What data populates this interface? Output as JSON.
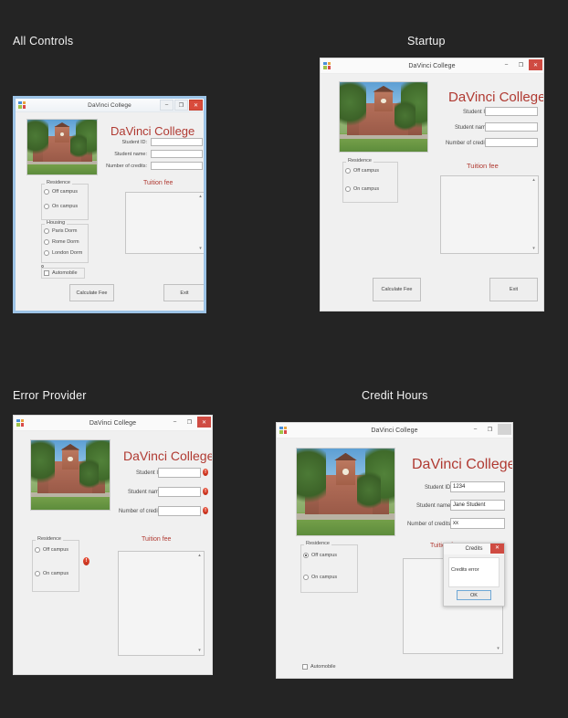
{
  "background_color": "#242424",
  "sections": [
    {
      "id": "all-controls",
      "label": "All Controls"
    },
    {
      "id": "startup",
      "label": "Startup"
    },
    {
      "id": "error-provider",
      "label": "Error Provider"
    },
    {
      "id": "credit-hours",
      "label": "Credit Hours"
    }
  ],
  "window_title": "DaVinci College",
  "brand": "DaVinci College",
  "colors": {
    "brand_red": "#b03a32",
    "accent_blue": "#9dc3e6",
    "close_red": "#d94b3c",
    "error_red": "#c22d18"
  },
  "window_buttons": {
    "minimize": "–",
    "maximize": "❐",
    "close": "✕"
  },
  "form": {
    "labels": {
      "student_id": "Student ID:",
      "student_name": "Student name:",
      "number_of_credits": "Number of credits:"
    },
    "tuition_fee_title": "Tuition fee",
    "residence_group": "Residence",
    "residence_options": [
      "Off campus",
      "On campus"
    ],
    "housing_group": "Housing",
    "housing_options": [
      "Paris Dorm",
      "Rome Dorm",
      "London Dorm"
    ],
    "automobile_label": "Automobile",
    "calculate_button": "Calculate Fee",
    "exit_button": "Exit",
    "scroll_up": "▴",
    "scroll_down": "▾"
  },
  "all_controls": {
    "values": {
      "student_id": "",
      "student_name": "",
      "number_of_credits": ""
    },
    "residence_selected": -1,
    "housing_selected": -1,
    "automobile_checked": false
  },
  "startup": {
    "values": {
      "student_id": "",
      "student_name": "",
      "number_of_credits": ""
    },
    "residence_selected": -1
  },
  "error_provider": {
    "values": {
      "student_id": "",
      "student_name": "",
      "number_of_credits": ""
    },
    "residence_selected": -1,
    "error_icon_glyph": "!",
    "error_count": 4
  },
  "credit_hours": {
    "values": {
      "student_id": "1234",
      "student_name": "Jane Student",
      "number_of_credits": "xx"
    },
    "residence_selected": 0,
    "automobile_checked": false,
    "dialog": {
      "title": "Credits",
      "message": "Credits error",
      "ok_label": "OK",
      "close_glyph": "✕"
    }
  }
}
